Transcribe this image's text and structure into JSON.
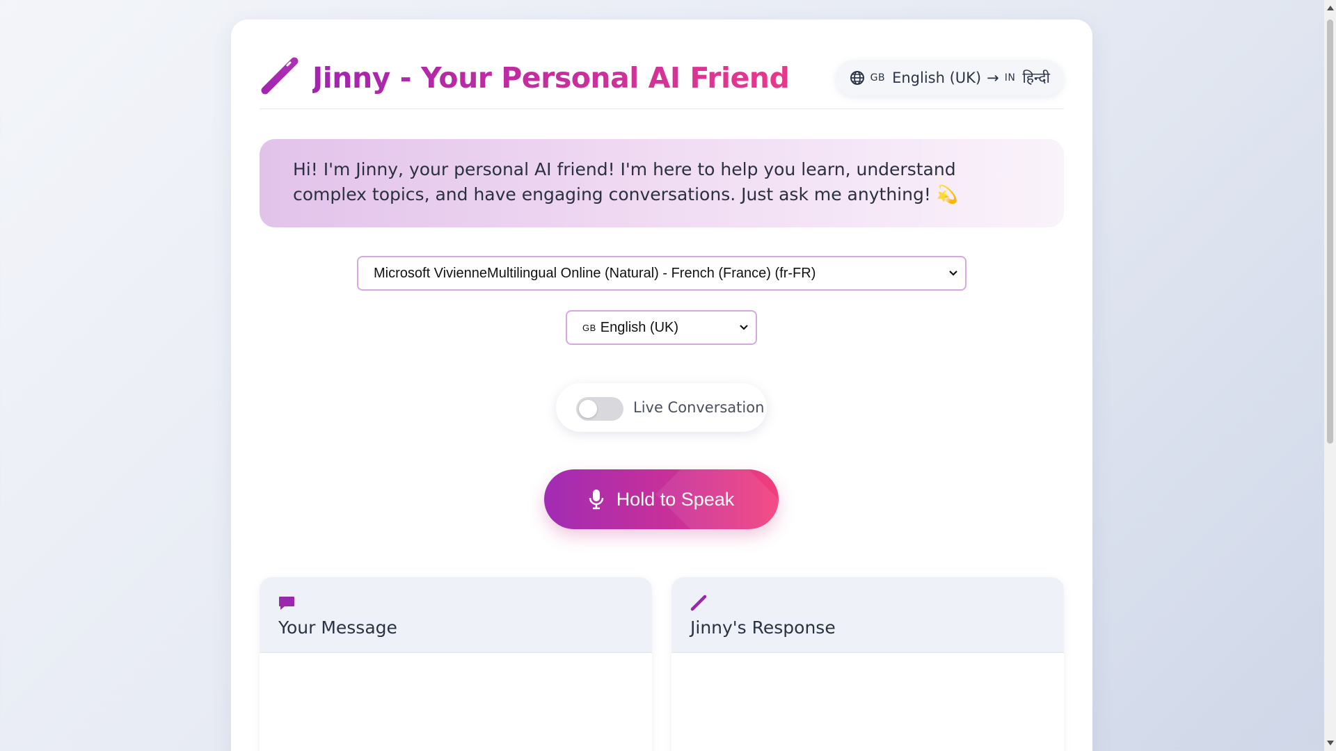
{
  "header": {
    "title": "Jinny - Your Personal AI Friend",
    "logo_icon": "magic-wand-icon",
    "language_pair": {
      "icon": "globe-icon",
      "from_flag": "GB",
      "from_label": "English (UK)",
      "arrow": "→",
      "to_flag": "IN",
      "to_label": "हिन्दी"
    }
  },
  "intro": {
    "text": "Hi! I'm Jinny, your personal AI friend! I'm here to help you learn, understand complex topics, and have engaging conversations. Just ask me anything! 💫"
  },
  "voice_select": {
    "selected": "Microsoft VivienneMultilingual Online (Natural) - French (France) (fr-FR)"
  },
  "language_select": {
    "flag": "GB",
    "selected": "English (UK)"
  },
  "live_toggle": {
    "label": "Live Conversation",
    "on": false
  },
  "speak_button": {
    "label": "Hold to Speak",
    "icon": "microphone-icon"
  },
  "panels": {
    "user": {
      "title": "Your Message",
      "icon": "chat-bubble-icon",
      "content": ""
    },
    "assistant": {
      "title": "Jinny's Response",
      "icon": "magic-wand-icon",
      "content": ""
    }
  },
  "colors": {
    "accent_purple": "#a324b0",
    "accent_pink": "#e8388c",
    "select_border": "#d9a6e4",
    "panel_header": "#eef1f7"
  }
}
